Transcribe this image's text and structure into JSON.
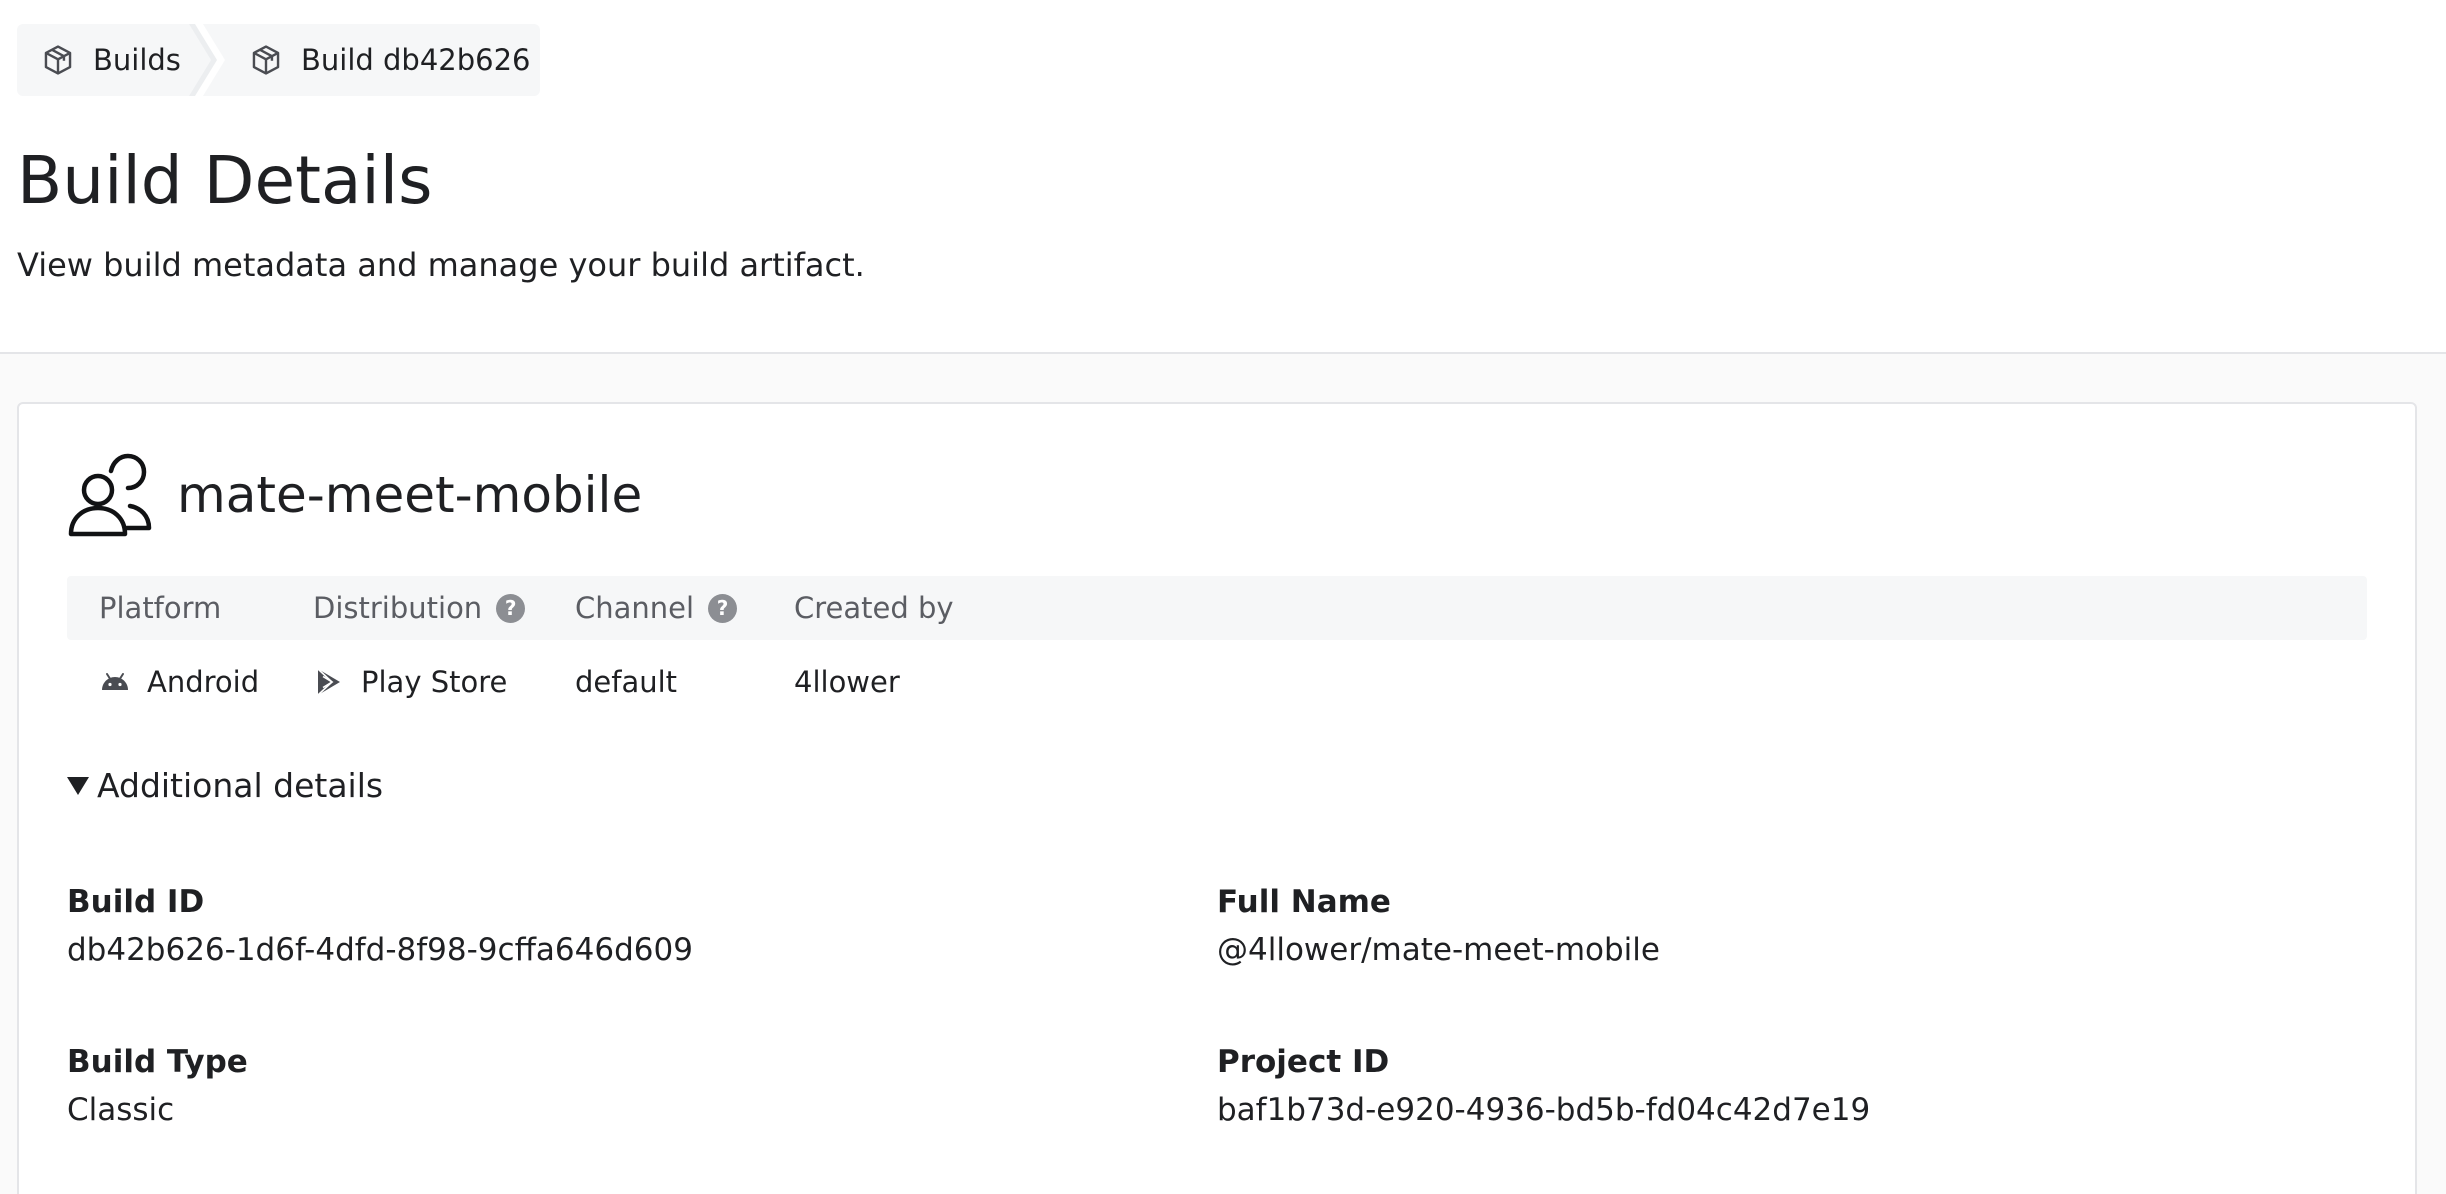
{
  "breadcrumb": {
    "items": [
      {
        "label": "Builds",
        "icon": "cube-icon"
      },
      {
        "label": "Build db42b626",
        "icon": "cube-icon"
      }
    ]
  },
  "header": {
    "title": "Build Details",
    "subtitle": "View build metadata and manage your build artifact."
  },
  "project": {
    "name": "mate-meet-mobile",
    "avatar_icon": "users-icon"
  },
  "meta": {
    "columns": {
      "platform": "Platform",
      "distribution": "Distribution",
      "channel": "Channel",
      "created_by": "Created by"
    },
    "help_glyph": "?",
    "values": {
      "platform": "Android",
      "platform_icon": "android-icon",
      "distribution": "Play Store",
      "distribution_icon": "play-store-icon",
      "channel": "default",
      "created_by": "4llower"
    }
  },
  "details": {
    "toggle_label": "Additional details",
    "expanded": true,
    "fields": {
      "build_id": {
        "label": "Build ID",
        "value": "db42b626-1d6f-4dfd-8f98-9cffa646d609"
      },
      "full_name": {
        "label": "Full Name",
        "value": "@4llower/mate-meet-mobile"
      },
      "build_type": {
        "label": "Build Type",
        "value": "Classic"
      },
      "project_id": {
        "label": "Project ID",
        "value": "baf1b73d-e920-4936-bd5b-fd04c42d7e19"
      }
    }
  },
  "colors": {
    "text": "#1f2023",
    "muted": "#5b5d63",
    "subtle_bg": "#f6f7f8",
    "border": "#e4e5e8",
    "help_dot": "#8c8e93"
  }
}
